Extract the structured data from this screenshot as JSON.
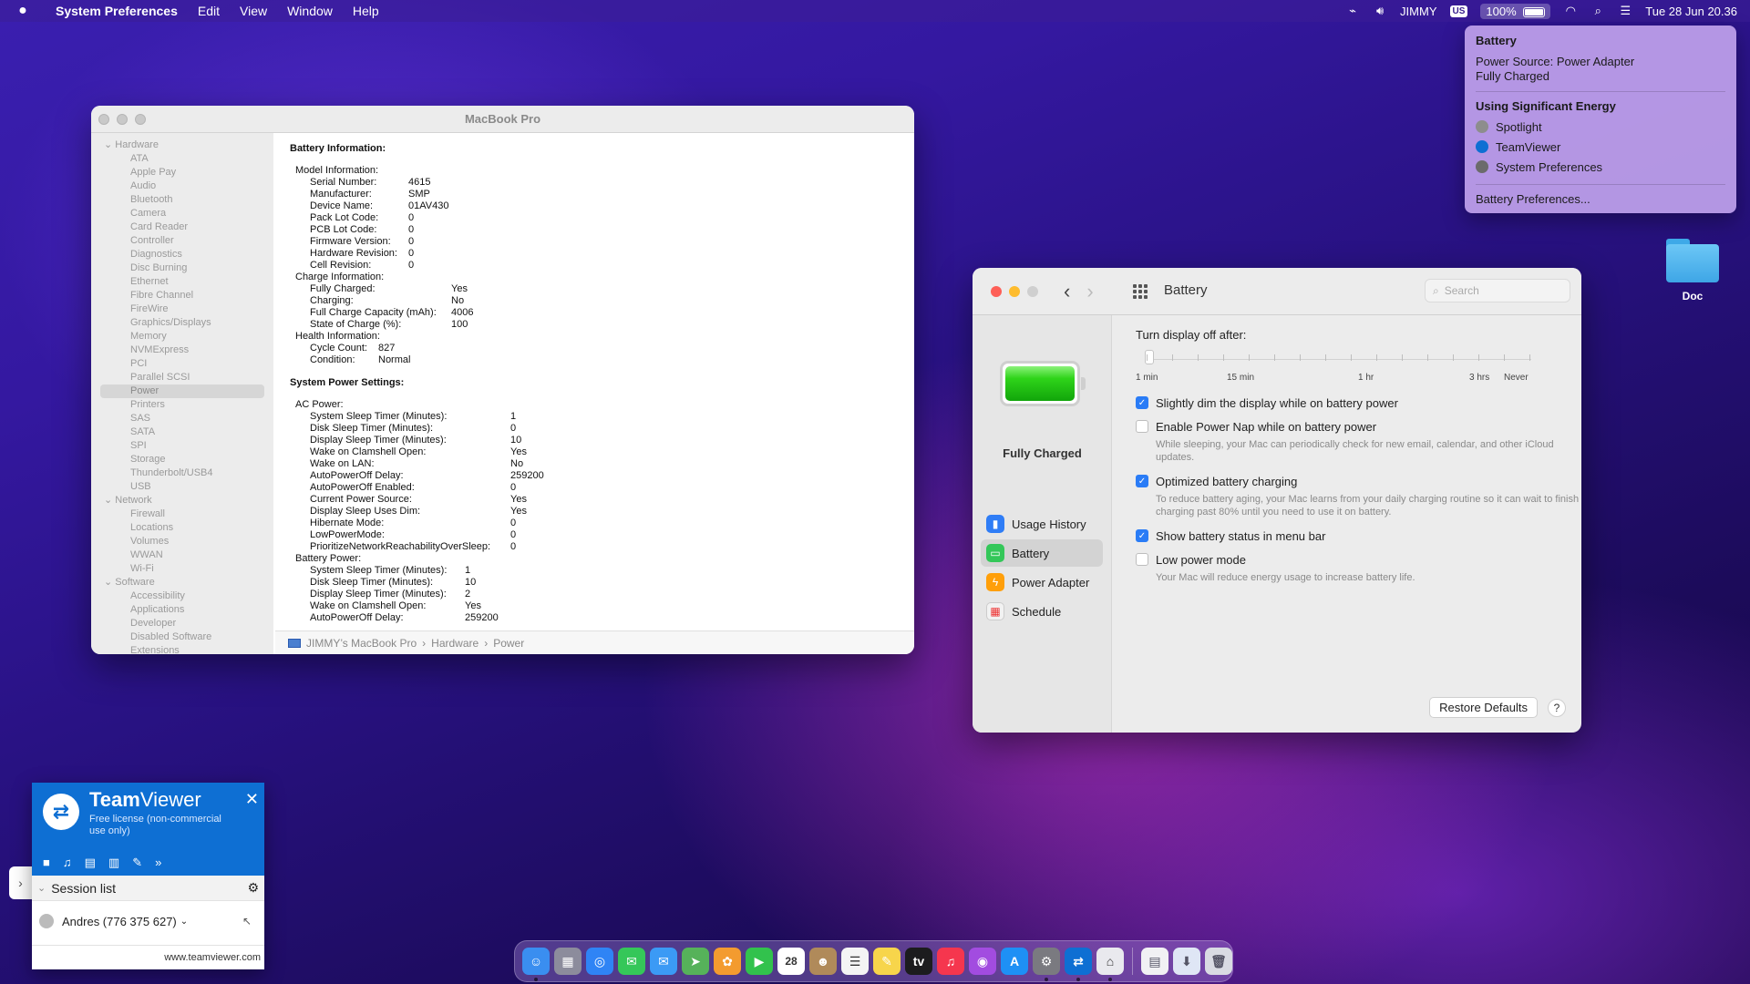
{
  "menubar": {
    "app_name": "System Preferences",
    "menus": [
      "Edit",
      "View",
      "Window",
      "Help"
    ],
    "user": "JIMMY",
    "input_source": "US",
    "battery_percent": "100%",
    "datetime": "Tue 28 Jun  20.36"
  },
  "battery_menu": {
    "title": "Battery",
    "power_source": "Power Source: Power Adapter",
    "status": "Fully Charged",
    "energy_header": "Using Significant Energy",
    "apps": [
      "Spotlight",
      "TeamViewer",
      "System Preferences"
    ],
    "prefs_link": "Battery Preferences..."
  },
  "sysinfo": {
    "title": "MacBook Pro",
    "sidebar": {
      "hardware_label": "Hardware",
      "hardware": [
        "ATA",
        "Apple Pay",
        "Audio",
        "Bluetooth",
        "Camera",
        "Card Reader",
        "Controller",
        "Diagnostics",
        "Disc Burning",
        "Ethernet",
        "Fibre Channel",
        "FireWire",
        "Graphics/Displays",
        "Memory",
        "NVMExpress",
        "PCI",
        "Parallel SCSI",
        "Power",
        "Printers",
        "SAS",
        "SATA",
        "SPI",
        "Storage",
        "Thunderbolt/USB4",
        "USB"
      ],
      "selected": "Power",
      "network_label": "Network",
      "network": [
        "Firewall",
        "Locations",
        "Volumes",
        "WWAN",
        "Wi-Fi"
      ],
      "software_label": "Software",
      "software": [
        "Accessibility",
        "Applications",
        "Developer",
        "Disabled Software",
        "Extensions"
      ]
    },
    "battery_info_heading": "Battery Information:",
    "model_info_label": "Model Information:",
    "model_info": [
      {
        "k": "Serial Number:",
        "v": "4615"
      },
      {
        "k": "Manufacturer:",
        "v": "SMP"
      },
      {
        "k": "Device Name:",
        "v": "01AV430"
      },
      {
        "k": "Pack Lot Code:",
        "v": "0"
      },
      {
        "k": "PCB Lot Code:",
        "v": "0"
      },
      {
        "k": "Firmware Version:",
        "v": "0"
      },
      {
        "k": "Hardware Revision:",
        "v": "0"
      },
      {
        "k": "Cell Revision:",
        "v": "0"
      }
    ],
    "charge_info_label": "Charge Information:",
    "charge_info": [
      {
        "k": "Fully Charged:",
        "v": "Yes"
      },
      {
        "k": "Charging:",
        "v": "No"
      },
      {
        "k": "Full Charge Capacity (mAh):",
        "v": "4006"
      },
      {
        "k": "State of Charge (%):",
        "v": "100"
      }
    ],
    "health_info_label": "Health Information:",
    "health_info": [
      {
        "k": "Cycle Count:",
        "v": "827"
      },
      {
        "k": "Condition:",
        "v": "Normal"
      }
    ],
    "power_settings_heading": "System Power Settings:",
    "ac_power_label": "AC Power:",
    "ac_power": [
      {
        "k": "System Sleep Timer (Minutes):",
        "v": "1"
      },
      {
        "k": "Disk Sleep Timer (Minutes):",
        "v": "0"
      },
      {
        "k": "Display Sleep Timer (Minutes):",
        "v": "10"
      },
      {
        "k": "Wake on Clamshell Open:",
        "v": "Yes"
      },
      {
        "k": "Wake on LAN:",
        "v": "No"
      },
      {
        "k": "AutoPowerOff Delay:",
        "v": "259200"
      },
      {
        "k": "AutoPowerOff Enabled:",
        "v": "0"
      },
      {
        "k": "Current Power Source:",
        "v": "Yes"
      },
      {
        "k": "Display Sleep Uses Dim:",
        "v": "Yes"
      },
      {
        "k": "Hibernate Mode:",
        "v": "0"
      },
      {
        "k": "LowPowerMode:",
        "v": "0"
      },
      {
        "k": "PrioritizeNetworkReachabilityOverSleep:",
        "v": "0"
      }
    ],
    "battery_power_label": "Battery Power:",
    "battery_power": [
      {
        "k": "System Sleep Timer (Minutes):",
        "v": "1"
      },
      {
        "k": "Disk Sleep Timer (Minutes):",
        "v": "10"
      },
      {
        "k": "Display Sleep Timer (Minutes):",
        "v": "2"
      },
      {
        "k": "Wake on Clamshell Open:",
        "v": "Yes"
      },
      {
        "k": "AutoPowerOff Delay:",
        "v": "259200"
      }
    ],
    "pathbar": [
      "JIMMY’s MacBook Pro",
      "Hardware",
      "Power"
    ]
  },
  "battery_prefs": {
    "title": "Battery",
    "search_placeholder": "Search",
    "status": "Fully Charged",
    "nav": [
      {
        "label": "Usage History",
        "icon": "chart-icon",
        "color": "#2f7df6"
      },
      {
        "label": "Battery",
        "icon": "battery-icon",
        "color": "#34c759"
      },
      {
        "label": "Power Adapter",
        "icon": "bolt-icon",
        "color": "#ff9f0a"
      },
      {
        "label": "Schedule",
        "icon": "calendar-icon",
        "color": "#f2f2f2"
      }
    ],
    "selected_nav": "Battery",
    "display_off_label": "Turn display off after:",
    "slider_labels": [
      "1 min",
      "15 min",
      "1 hr",
      "3 hrs",
      "Never"
    ],
    "slider_value": "1 min",
    "options": [
      {
        "label": "Slightly dim the display while on battery power",
        "checked": true,
        "desc": ""
      },
      {
        "label": "Enable Power Nap while on battery power",
        "checked": false,
        "desc": "While sleeping, your Mac can periodically check for new email, calendar, and other iCloud updates."
      },
      {
        "label": "Optimized battery charging",
        "checked": true,
        "desc": "To reduce battery aging, your Mac learns from your daily charging routine so it can wait to finish charging past 80% until you need to use it on battery."
      },
      {
        "label": "Show battery status in menu bar",
        "checked": true,
        "desc": ""
      },
      {
        "label": "Low power mode",
        "checked": false,
        "desc": "Your Mac will reduce energy usage to increase battery life."
      }
    ],
    "restore_label": "Restore Defaults",
    "help_label": "?",
    "accent": "#2a7cf6"
  },
  "desktop": {
    "folder_label": "Doc"
  },
  "teamviewer": {
    "brand_a": "Team",
    "brand_b": "Viewer",
    "license": "Free license (non-commercial use only)",
    "session_list": "Session list",
    "user": "Andres (776 375 627)",
    "footer": "www.teamviewer.com",
    "accent": "#0e6fd3"
  },
  "dock": {
    "apps": [
      {
        "name": "finder-icon",
        "color": "#3a8ef0",
        "glyph": "☺",
        "running": true
      },
      {
        "name": "launchpad-icon",
        "color": "#8c8c9c",
        "glyph": "▦",
        "running": false
      },
      {
        "name": "safari-icon",
        "color": "#2f84f5",
        "glyph": "◎",
        "running": false
      },
      {
        "name": "messages-icon",
        "color": "#35c759",
        "glyph": "✉",
        "running": false
      },
      {
        "name": "mail-icon",
        "color": "#3b9af5",
        "glyph": "✉",
        "running": false
      },
      {
        "name": "maps-icon",
        "color": "#56b25a",
        "glyph": "➤",
        "running": false
      },
      {
        "name": "photos-icon",
        "color": "#f39b2f",
        "glyph": "✿",
        "running": false
      },
      {
        "name": "facetime-icon",
        "color": "#32c24d",
        "glyph": "▶",
        "running": false
      },
      {
        "name": "calendar-icon",
        "color": "#ffffff",
        "glyph": "28",
        "running": false
      },
      {
        "name": "contacts-icon",
        "color": "#b08a5a",
        "glyph": "☻",
        "running": false
      },
      {
        "name": "reminders-icon",
        "color": "#f4f4f4",
        "glyph": "☰",
        "running": false
      },
      {
        "name": "notes-icon",
        "color": "#f7d54b",
        "glyph": "✎",
        "running": false
      },
      {
        "name": "tv-icon",
        "color": "#1c1c1e",
        "glyph": "tv",
        "running": false
      },
      {
        "name": "music-icon",
        "color": "#f5364e",
        "glyph": "♫",
        "running": false
      },
      {
        "name": "podcasts-icon",
        "color": "#a24ce0",
        "glyph": "◉",
        "running": false
      },
      {
        "name": "app-store-icon",
        "color": "#1e90f5",
        "glyph": "A",
        "running": false
      },
      {
        "name": "system-preferences-icon",
        "color": "#7a7a80",
        "glyph": "⚙",
        "running": true
      },
      {
        "name": "teamviewer-icon",
        "color": "#0e6fd3",
        "glyph": "⇄",
        "running": true
      },
      {
        "name": "system-information-icon",
        "color": "#e9e9ee",
        "glyph": "⌂",
        "running": true
      }
    ],
    "trailing": [
      {
        "name": "document-icon",
        "color": "#f1f1f4",
        "glyph": "▤"
      },
      {
        "name": "downloads-icon",
        "color": "#dfe6f5",
        "glyph": "⬇"
      },
      {
        "name": "trash-icon",
        "color": "#d9dbe3",
        "glyph": "🗑"
      }
    ]
  }
}
